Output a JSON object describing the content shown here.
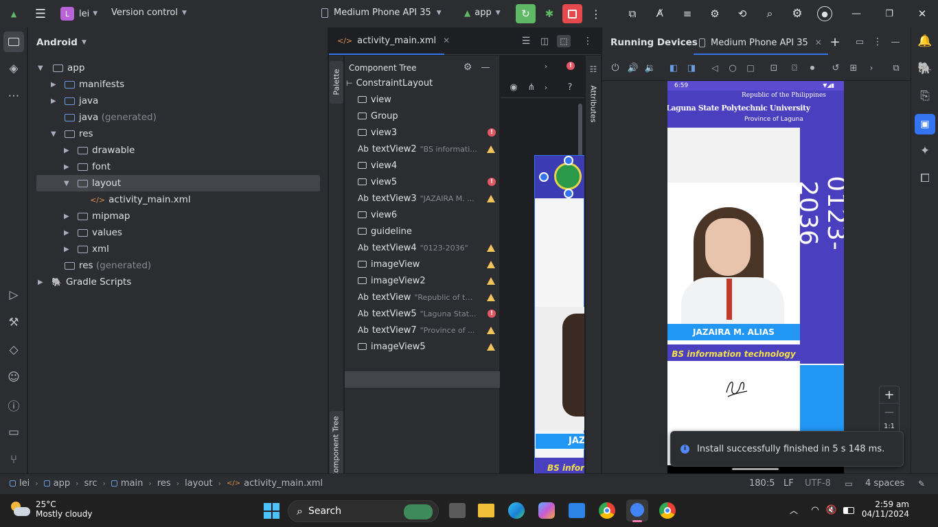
{
  "titlebar": {
    "project_initial": "L",
    "project_name": "lei",
    "vcs": "Version control",
    "device": "Medium Phone API 35",
    "run_config": "app"
  },
  "project_panel": {
    "view_mode": "Android",
    "tree": [
      {
        "label": "app",
        "suffix": ""
      },
      {
        "label": "manifests",
        "suffix": ""
      },
      {
        "label": "java",
        "suffix": ""
      },
      {
        "label": "java",
        "suffix": "(generated)"
      },
      {
        "label": "res",
        "suffix": ""
      },
      {
        "label": "drawable",
        "suffix": ""
      },
      {
        "label": "font",
        "suffix": ""
      },
      {
        "label": "layout",
        "suffix": ""
      },
      {
        "label": "activity_main.xml",
        "suffix": ""
      },
      {
        "label": "mipmap",
        "suffix": ""
      },
      {
        "label": "values",
        "suffix": ""
      },
      {
        "label": "xml",
        "suffix": ""
      },
      {
        "label": "res",
        "suffix": "(generated)"
      },
      {
        "label": "Gradle Scripts",
        "suffix": ""
      }
    ]
  },
  "editor": {
    "tab": "activity_main.xml",
    "palette_label": "Palette",
    "component_tree_title": "Component Tree",
    "component_tree_side_label": "Component Tree",
    "attributes_label": "Attributes",
    "components": [
      {
        "prefix": "",
        "name": "ConstraintLayout",
        "hint": "",
        "status": "none"
      },
      {
        "prefix": "",
        "name": "view",
        "hint": "",
        "status": "none"
      },
      {
        "prefix": "",
        "name": "Group",
        "hint": "",
        "status": "none"
      },
      {
        "prefix": "",
        "name": "view3",
        "hint": "",
        "status": "error"
      },
      {
        "prefix": "Ab",
        "name": "textView2",
        "hint": "\"BS informati...",
        "status": "warn"
      },
      {
        "prefix": "",
        "name": "view4",
        "hint": "",
        "status": "none"
      },
      {
        "prefix": "",
        "name": "view5",
        "hint": "",
        "status": "error"
      },
      {
        "prefix": "Ab",
        "name": "textView3",
        "hint": "\"JAZAIRA M. ...",
        "status": "warn"
      },
      {
        "prefix": "",
        "name": "view6",
        "hint": "",
        "status": "none"
      },
      {
        "prefix": "",
        "name": "guideline",
        "hint": "",
        "status": "none"
      },
      {
        "prefix": "Ab",
        "name": "textView4",
        "hint": "\"0123-2036\"",
        "status": "warn"
      },
      {
        "prefix": "",
        "name": "imageView",
        "hint": "",
        "status": "warn"
      },
      {
        "prefix": "",
        "name": "imageView2",
        "hint": "",
        "status": "warn"
      },
      {
        "prefix": "Ab",
        "name": "textView",
        "hint": "\"Republic of th...",
        "status": "warn"
      },
      {
        "prefix": "Ab",
        "name": "textView5",
        "hint": "\"Laguna Stat...",
        "status": "error"
      },
      {
        "prefix": "Ab",
        "name": "textView7",
        "hint": "\"Province of ...",
        "status": "warn"
      },
      {
        "prefix": "",
        "name": "imageView5",
        "hint": "",
        "status": "warn"
      }
    ],
    "preview_texts": {
      "name": "JAZ",
      "course": "BS infor"
    }
  },
  "running_devices": {
    "title": "Running Devices",
    "device_tab": "Medium Phone API 35",
    "zoom_label": "1:1",
    "phone": {
      "time": "6:59",
      "republic": "Republic of the Philippines",
      "university": "Laguna State Polytechnic University",
      "province": "Province of Laguna",
      "id_number": "0123-2036",
      "student_name": "JAZAIRA M. ALIAS",
      "course": "BS information technology"
    },
    "notification": "Install successfully finished in 5 s 148 ms."
  },
  "statusbar": {
    "breadcrumb": [
      "lei",
      "app",
      "src",
      "main",
      "res",
      "layout",
      "activity_main.xml"
    ],
    "position": "180:5",
    "line_sep": "LF",
    "encoding": "UTF-8",
    "indent": "4 spaces"
  },
  "taskbar": {
    "temp": "25°C",
    "weather": "Mostly cloudy",
    "search": "Search",
    "time": "2:59 am",
    "date": "04/11/2024"
  },
  "colors": {
    "accent": "#3574f0",
    "id_blue": "#2196f3",
    "id_purple": "#4a3fbf",
    "warn": "#f2c55c",
    "error": "#e55765",
    "run_green": "#5fb865",
    "stop_red": "#e5484d"
  }
}
